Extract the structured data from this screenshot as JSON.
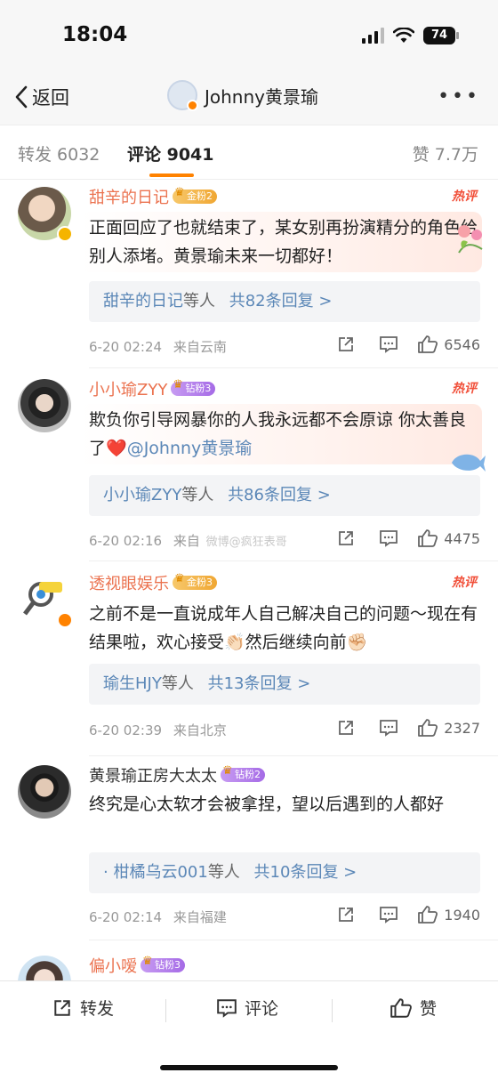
{
  "status": {
    "time": "18:04",
    "battery": "74"
  },
  "nav": {
    "back_label": "返回",
    "title": "Johnny黄景瑜"
  },
  "tabs": [
    {
      "label": "转发 6032"
    },
    {
      "label": "评论 9041"
    },
    {
      "label": "赞 7.7万"
    }
  ],
  "hot_label": "热评",
  "comments": [
    {
      "user": "甜辛的日记",
      "badge": "金粉2",
      "text": "正面回应了也就结束了，某女别再扮演精分的角色给别人添堵。黄景瑜未来一切都好！",
      "reply_user": "甜辛的日记",
      "reply_etc": "等人",
      "reply_count": "共82条回复 >",
      "time": "6-20 02:24",
      "location": "来自云南",
      "likes": "6546"
    },
    {
      "user": "小小瑜ZYY",
      "badge": "钻粉3",
      "text_before": "欺负你引导网暴你的人我永远都不会原谅 你太善良了",
      "emoji": "❤️",
      "mention": "@Johnny黄景瑜",
      "reply_user": "小小瑜ZYY",
      "reply_etc": "等人",
      "reply_count": "共86条回复 >",
      "time": "6-20 02:16",
      "location": "来自",
      "watermark": "微博@疯狂表哥",
      "likes": "4475"
    },
    {
      "user": "透视眼娱乐",
      "badge": "金粉3",
      "text": "之前不是一直说成年人自己解决自己的问题～现在有结果啦，欢心接受👏🏻然后继续向前✊🏻",
      "reply_user": "瑜生HJY",
      "reply_etc": "等人",
      "reply_count": "共13条回复 >",
      "time": "6-20 02:39",
      "location": "来自北京",
      "likes": "2327"
    },
    {
      "user": "黄景瑜正房大太太",
      "badge": "钻粉2",
      "text": "终究是心太软才会被拿捏，望以后遇到的人都好",
      "reply_user": "· 柑橘乌云001",
      "reply_etc": "等人",
      "reply_count": "共10条回复 >",
      "time": "6-20 02:14",
      "location": "来自福建",
      "likes": "1940"
    },
    {
      "user": "偏小嗳",
      "badge": "钻粉3"
    }
  ],
  "bottom": {
    "repost": "转发",
    "comment": "评论",
    "like": "赞"
  },
  "colors": {
    "accent": "#ff8200",
    "username": "#eb7350",
    "link": "#5b87b7",
    "hot": "#f1503a"
  }
}
